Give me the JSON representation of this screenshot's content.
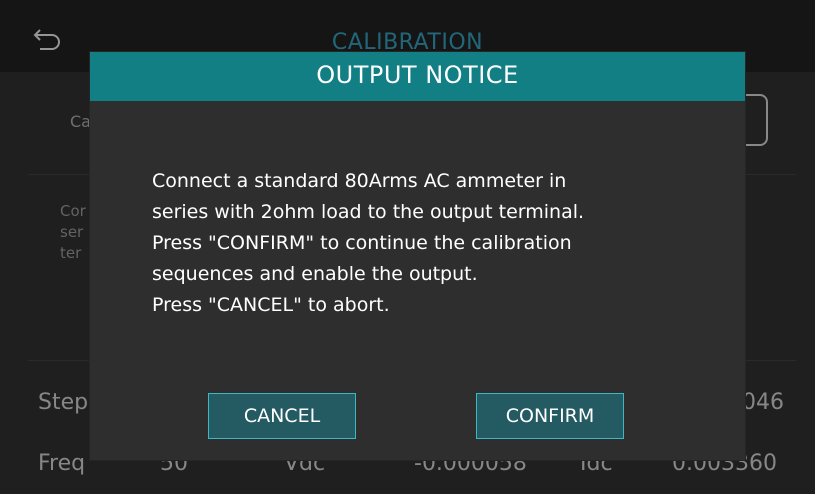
{
  "page": {
    "title": "CALIBRATION",
    "back_icon": "back-arrow-icon",
    "field_label": "Ca",
    "instruction_lines": [
      "Cor",
      "ser",
      "ter"
    ],
    "rows": [
      {
        "label": "Step",
        "value_right": "046"
      },
      {
        "label": "Freq",
        "freq": "50",
        "vunit": "Vdc",
        "vvalue": "-0.000058",
        "iunit": "Idc",
        "ivalue": "0.003360"
      }
    ]
  },
  "dialog": {
    "title": "OUTPUT NOTICE",
    "message_lines": [
      "Connect a standard 80Arms AC ammeter in",
      "series with 2ohm load to the output terminal.",
      "Press \"CONFIRM\" to continue the calibration",
      "sequences and enable the output.",
      "Press \"CANCEL\" to abort."
    ],
    "cancel_label": "CANCEL",
    "confirm_label": "CONFIRM"
  },
  "colors": {
    "accent": "#127f84",
    "title_blue": "#2f8fa8",
    "button_bg": "#245b63",
    "button_border": "#3fb6c4"
  }
}
